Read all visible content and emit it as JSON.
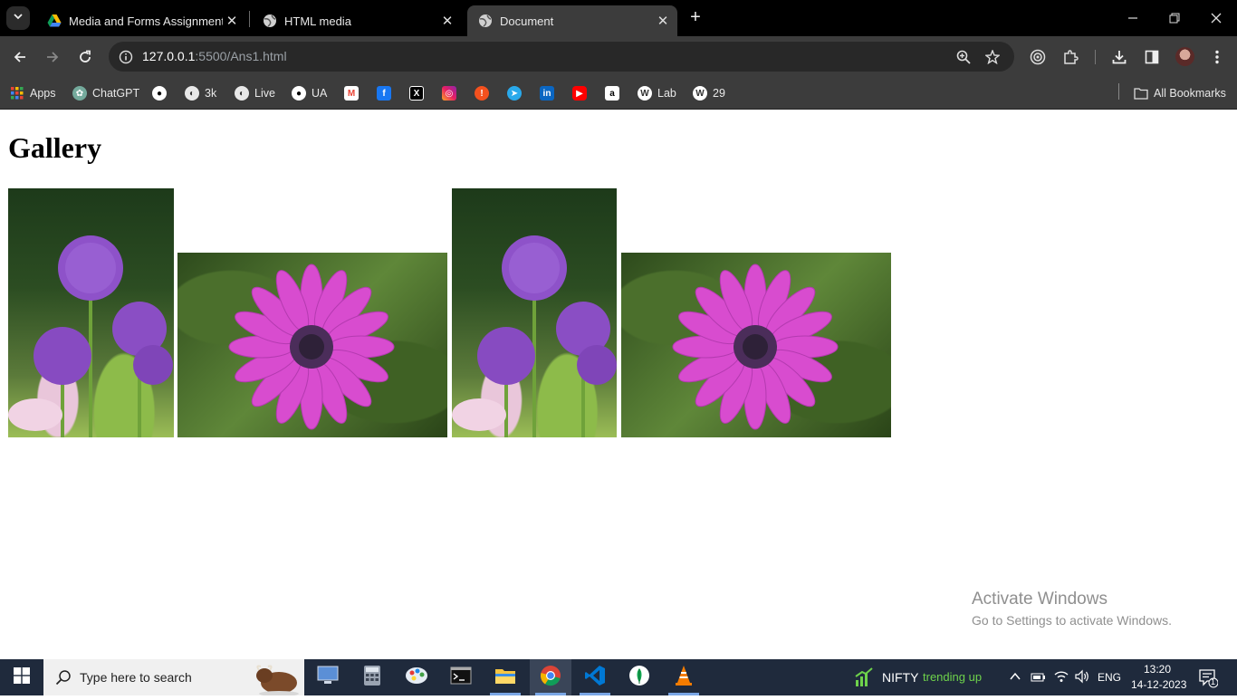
{
  "browser": {
    "tabs": [
      {
        "title": "Media and Forms Assignment.p",
        "favicon": "google-drive-icon",
        "active": false
      },
      {
        "title": "HTML media",
        "favicon": "globe-icon",
        "active": false
      },
      {
        "title": "Document",
        "favicon": "globe-icon",
        "active": true
      }
    ],
    "url_host": "127.0.0.1",
    "url_rest": ":5500/Ans1.html",
    "bookmarks": [
      {
        "label": "Apps",
        "icon": "apps-grid-icon"
      },
      {
        "label": "ChatGPT",
        "icon": "chatgpt-icon"
      },
      {
        "label": "",
        "icon": "github-icon"
      },
      {
        "label": "3k",
        "icon": "globe-icon"
      },
      {
        "label": "Live",
        "icon": "globe-icon"
      },
      {
        "label": "UA",
        "icon": "github-icon"
      },
      {
        "label": "",
        "icon": "gmail-icon"
      },
      {
        "label": "",
        "icon": "facebook-icon"
      },
      {
        "label": "",
        "icon": "x-icon"
      },
      {
        "label": "",
        "icon": "instagram-icon"
      },
      {
        "label": "",
        "icon": "alert-icon"
      },
      {
        "label": "",
        "icon": "telegram-icon"
      },
      {
        "label": "",
        "icon": "linkedin-icon"
      },
      {
        "label": "",
        "icon": "youtube-icon"
      },
      {
        "label": "",
        "icon": "amazon-icon"
      },
      {
        "label": "Lab",
        "icon": "wordpress-icon"
      },
      {
        "label": "29",
        "icon": "wordpress-icon"
      }
    ],
    "all_bookmarks": "All Bookmarks"
  },
  "page": {
    "heading": "Gallery",
    "images": [
      {
        "subject": "purple allium flowers"
      },
      {
        "subject": "pink daisy flower"
      },
      {
        "subject": "purple allium flowers"
      },
      {
        "subject": "pink daisy flower"
      }
    ]
  },
  "watermark": {
    "title": "Activate Windows",
    "subtitle": "Go to Settings to activate Windows."
  },
  "taskbar": {
    "search_placeholder": "Type here to search",
    "nifty_label": "NIFTY",
    "nifty_status": "trending up",
    "language": "ENG",
    "time": "13:20",
    "date": "14-12-2023",
    "notification_count": "1"
  },
  "colors": {
    "titlebar": "#000000",
    "toolbar": "#3c3c3c",
    "taskbar": "#1f2a3c",
    "trending_green": "#6ed24b"
  }
}
